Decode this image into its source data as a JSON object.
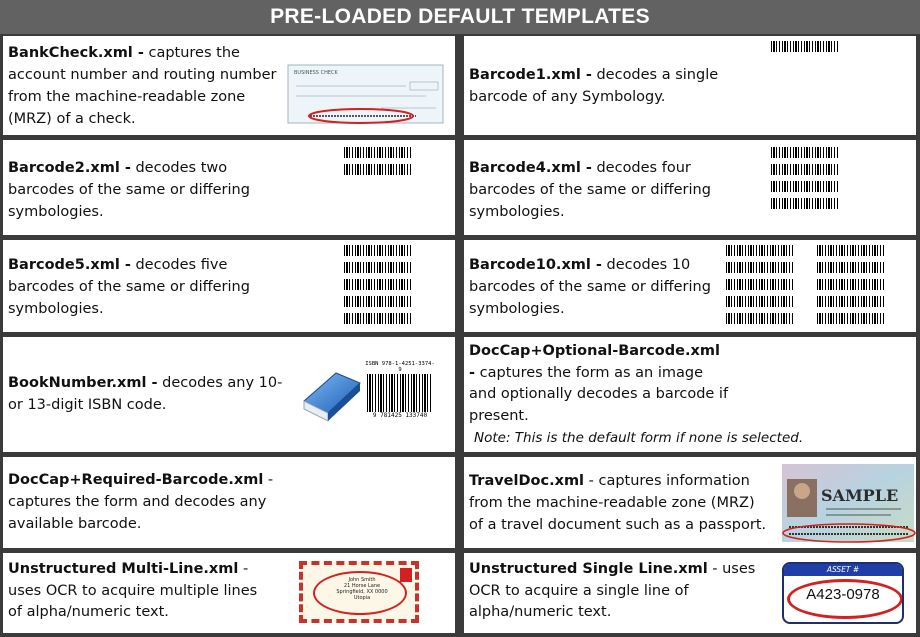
{
  "header": {
    "title": "PRE-LOADED DEFAULT TEMPLATES"
  },
  "templates": {
    "bankcheck": {
      "name": "BankCheck.xml -",
      "desc": " captures the account number and routing number from the machine-readable zone (MRZ) of a check."
    },
    "barcode1": {
      "name": "Barcode1.xml -",
      "desc": " decodes a single barcode of any Symbology."
    },
    "barcode2": {
      "name": "Barcode2.xml -",
      "desc": " decodes two barcodes of the same or differing symbologies."
    },
    "barcode4": {
      "name": "Barcode4.xml -",
      "desc": " decodes four barcodes of the same or differing symbologies."
    },
    "barcode5": {
      "name": "Barcode5.xml -",
      "desc": " decodes five barcodes of the same or differing symbologies."
    },
    "barcode10": {
      "name": "Barcode10.xml -",
      "desc": " decodes 10 barcodes of the same or differing symbologies."
    },
    "booknumber": {
      "name": "BookNumber.xml -",
      "desc": " decodes any 10- or 13-digit ISBN code."
    },
    "docopt": {
      "name": "DocCap+Optional-Barcode.xml -",
      "desc": " captures the form as an image and optionally decodes a barcode if present.",
      "note": "Note: This is the default form if none is selected."
    },
    "docreq": {
      "name": "DocCap+Required-Barcode.xml",
      "desc": " - captures the form and decodes any available barcode."
    },
    "traveldoc": {
      "name": "TravelDoc.xml",
      "desc": " - captures information from the machine-readable zone (MRZ) of a travel document such as a passport."
    },
    "multiline": {
      "name": "Unstructured Multi-Line.xml",
      "desc": " - uses OCR to acquire multiple lines of alpha/numeric text."
    },
    "singleline": {
      "name": "Unstructured Single Line.xml",
      "desc": " - uses OCR to acquire a single line of alpha/numeric text."
    }
  },
  "images": {
    "check_title": "BUSINESS CHECK",
    "isbn_top": "ISBN 978-1-4251-3374-9",
    "isbn_bottom": "9 781425 133740",
    "envelope_lines": [
      "John Smith",
      "21 Horse Lane",
      "Springfield, XX 0000",
      "Utopia"
    ],
    "passport_sample": "SAMPLE",
    "asset_label": "ASSET #",
    "asset_number": "A423-0978"
  },
  "colors": {
    "title_bar": "#626262",
    "grid": "#3b3b3b",
    "highlight": "#d42020"
  }
}
